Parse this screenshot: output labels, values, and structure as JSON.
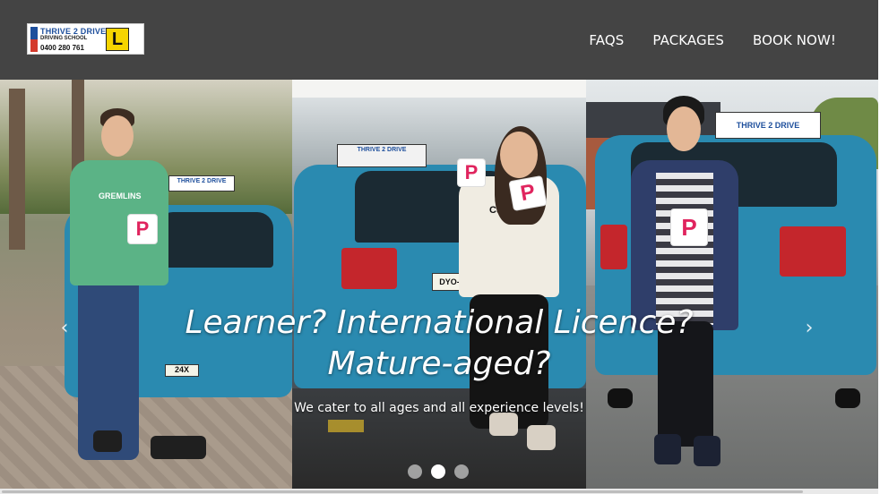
{
  "logo": {
    "brand": "THRIVE 2 DRIVE",
    "sub": "DRIVING SCHOOL",
    "phone": "0400 280 761",
    "plate_letter": "L",
    "icon": "logo-image"
  },
  "nav": {
    "items": [
      "FAQS",
      "PACKAGES",
      "BOOK NOW!"
    ]
  },
  "carousel": {
    "title": "Learner? International Licence? Mature-aged?",
    "subtitle": "We cater to all ages and all experience levels!",
    "prev_icon": "chevron-left-icon",
    "next_icon": "chevron-right-icon",
    "prev_glyph": "‹",
    "next_glyph": "›",
    "slide_count": 3,
    "active_slide": 2
  },
  "photos": {
    "p_plate": "P",
    "l_plate": "L",
    "roof_sign_1": "THRIVE 2 DRIVE",
    "roof_sign_2": "THRIVE 2 DRIVE",
    "roof_sign_3": "THRIVE 2 DRIVE",
    "plate_1": "24X",
    "plate_2": "DYO-2",
    "shirt_text": "GREMLINS",
    "shirt_text_2": "C&M"
  },
  "colors": {
    "header_bg": "#444444",
    "p_plate": "#e0245e",
    "l_plate": "#f5d400",
    "car": "#2a8ab0"
  }
}
